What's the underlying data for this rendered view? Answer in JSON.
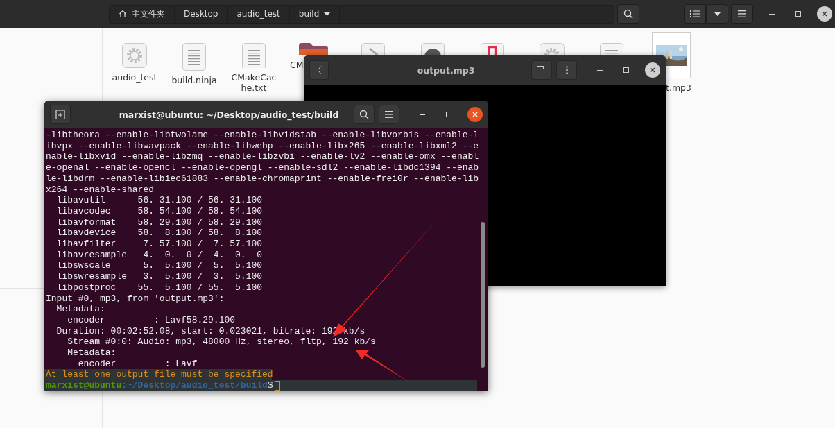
{
  "file_manager": {
    "breadcrumbs": [
      {
        "label": "主文件夹",
        "kind": "home"
      },
      {
        "label": "Desktop",
        "kind": "folder"
      },
      {
        "label": "audio_test",
        "kind": "folder"
      },
      {
        "label": "build",
        "kind": "dropdown"
      }
    ],
    "files": [
      {
        "label": "audio_test",
        "kind": "executable"
      },
      {
        "label": "build.ninja",
        "kind": "text"
      },
      {
        "label": "CMakeCache.txt",
        "kind": "text"
      },
      {
        "label": "CM",
        "kind": "folder"
      },
      {
        "kind": "script"
      },
      {
        "kind": "disc"
      },
      {
        "kind": "music"
      },
      {
        "kind": "executable"
      },
      {
        "kind": "text"
      },
      {
        "label": "t.mp3"
      }
    ]
  },
  "player": {
    "title": "output.mp3"
  },
  "terminal": {
    "title": "marxist@ubuntu: ~/Desktop/audio_test/build",
    "lines": [
      {
        "kind": "output",
        "text": "-libtheora --enable-libtwolame --enable-libvidstab --enable-libvorbis --enable-l"
      },
      {
        "kind": "output",
        "text": "ibvpx --enable-libwavpack --enable-libwebp --enable-libx265 --enable-libxml2 --e"
      },
      {
        "kind": "output",
        "text": "nable-libxvid --enable-libzmq --enable-libzvbi --enable-lv2 --enable-omx --enabl"
      },
      {
        "kind": "output",
        "text": "e-openal --enable-opencl --enable-opengl --enable-sdl2 --enable-libdc1394 --enab"
      },
      {
        "kind": "output",
        "text": "le-libdrm --enable-libiec61883 --enable-chromaprint --enable-frei0r --enable-lib"
      },
      {
        "kind": "output",
        "text": "x264 --enable-shared"
      },
      {
        "kind": "output",
        "text": "  libavutil      56. 31.100 / 56. 31.100"
      },
      {
        "kind": "output",
        "text": "  libavcodec     58. 54.100 / 58. 54.100"
      },
      {
        "kind": "output",
        "text": "  libavformat    58. 29.100 / 58. 29.100"
      },
      {
        "kind": "output",
        "text": "  libavdevice    58.  8.100 / 58.  8.100"
      },
      {
        "kind": "output",
        "text": "  libavfilter     7. 57.100 /  7. 57.100"
      },
      {
        "kind": "output",
        "text": "  libavresample   4.  0.  0 /  4.  0.  0"
      },
      {
        "kind": "output",
        "text": "  libswscale      5.  5.100 /  5.  5.100"
      },
      {
        "kind": "output",
        "text": "  libswresample   3.  5.100 /  3.  5.100"
      },
      {
        "kind": "output",
        "text": "  libpostproc    55.  5.100 / 55.  5.100"
      },
      {
        "kind": "output",
        "text": "Input #0, mp3, from 'output.mp3':"
      },
      {
        "kind": "output",
        "text": "  Metadata:"
      },
      {
        "kind": "output",
        "text": "    encoder         : Lavf58.29.100"
      },
      {
        "kind": "output",
        "text": "  Duration: 00:02:52.08, start: 0.023021, bitrate: 192 kb/s"
      },
      {
        "kind": "output",
        "text": "    Stream #0:0: Audio: mp3, 48000 Hz, stereo, fltp, 192 kb/s"
      },
      {
        "kind": "output",
        "text": "    Metadata:"
      },
      {
        "kind": "output",
        "text": "      encoder         : Lavf"
      },
      {
        "kind": "error",
        "text": "At least one output file must be specified"
      }
    ],
    "prompt": {
      "user": "marxist@ubuntu",
      "path": ":~/Desktop/audio_test/build",
      "symbol": "$"
    }
  }
}
